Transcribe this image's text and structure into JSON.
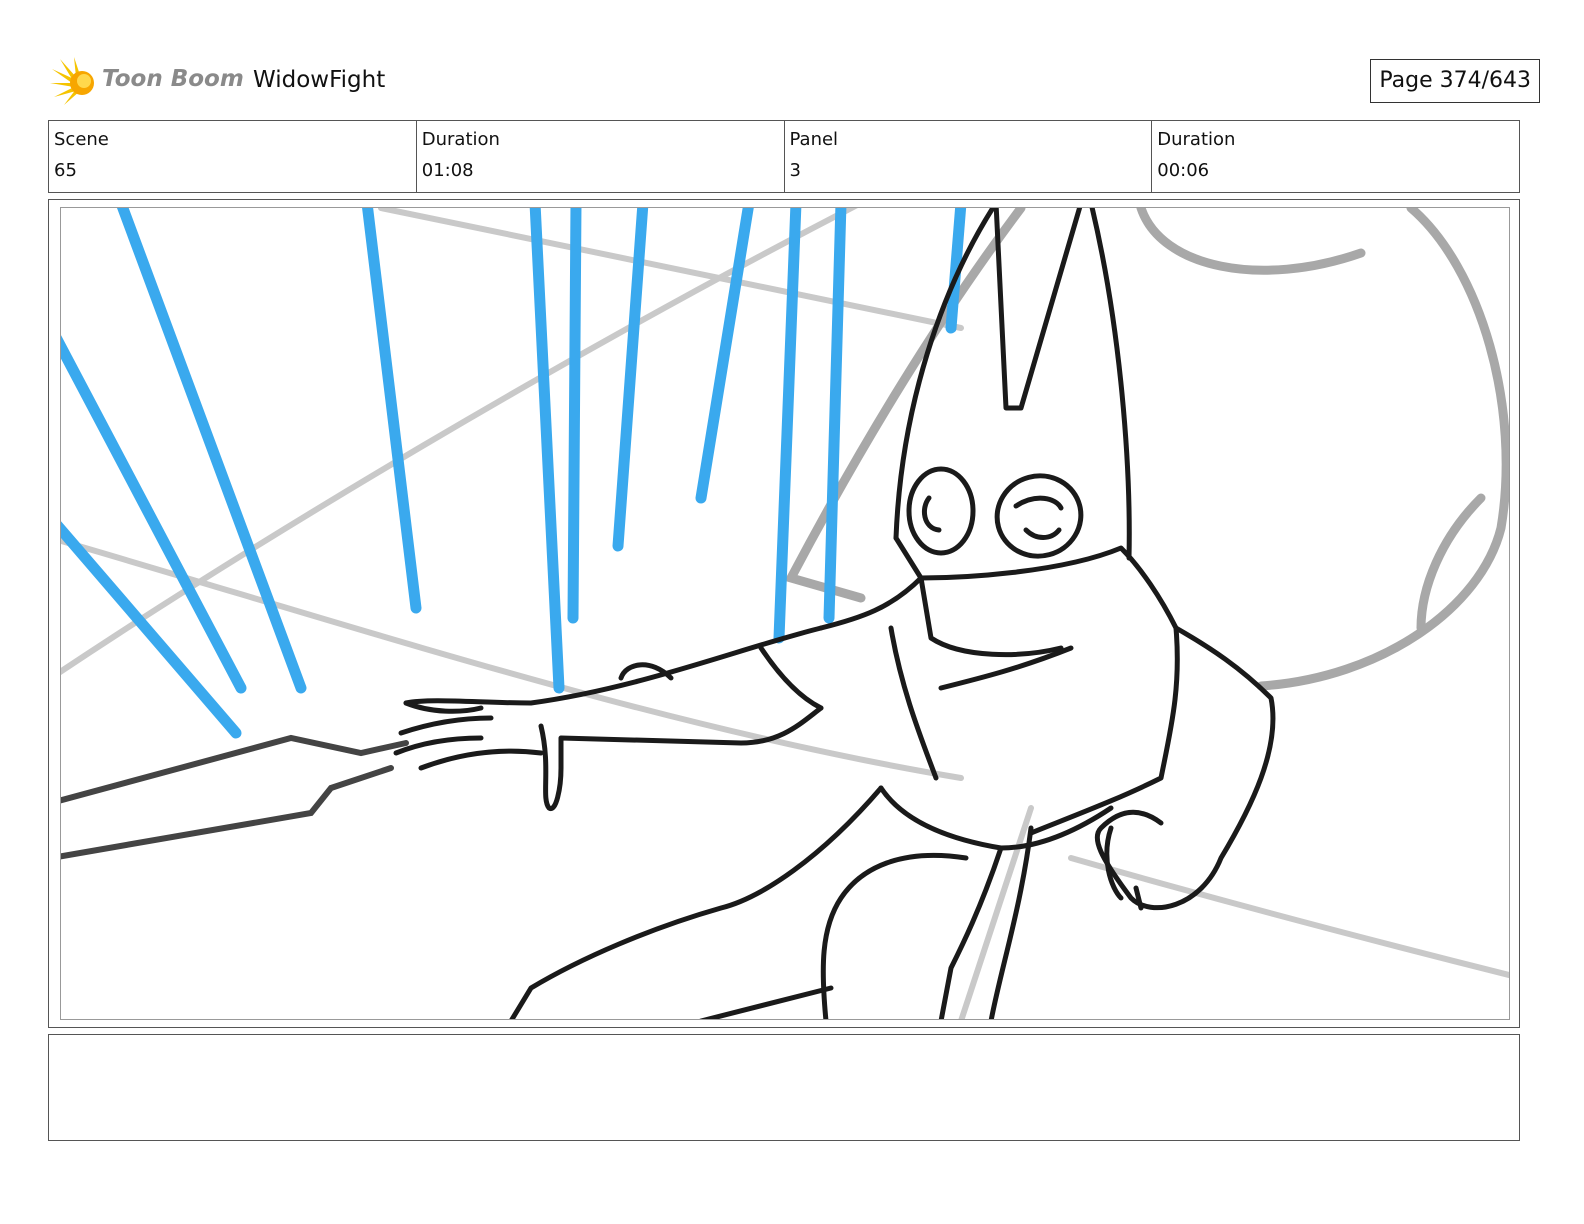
{
  "header": {
    "logo_text": "Toon Boom",
    "project_title": "WidowFight",
    "page_label": "Page 374/643"
  },
  "info": {
    "scene_label": "Scene",
    "scene_value": "65",
    "scene_duration_label": "Duration",
    "scene_duration_value": "01:08",
    "panel_label": "Panel",
    "panel_value": "3",
    "panel_duration_label": "Duration",
    "panel_duration_value": "00:06"
  },
  "notes": {
    "text": ""
  },
  "colors": {
    "speed_lines": "#3aa9ee",
    "ink": "#1a1a1a",
    "background_lines": "#bdbdbd",
    "logo_star": "#f2b705"
  }
}
